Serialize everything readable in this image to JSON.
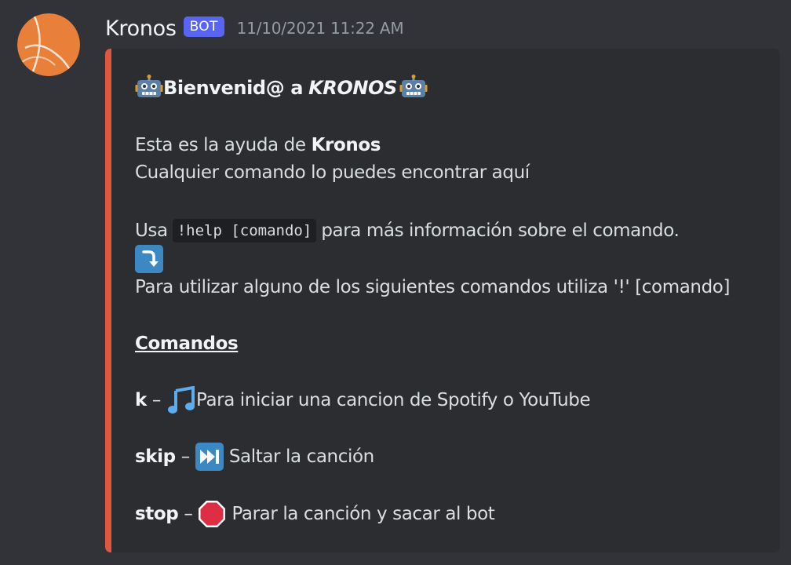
{
  "message": {
    "username": "Kronos",
    "bot_tag": "BOT",
    "timestamp": "11/10/2021 11:22 AM",
    "avatar_icon": "basketball-icon"
  },
  "embed": {
    "accent_color": "#e0573d",
    "title_prefix": "Bienvenid@ a",
    "title_name": "KRONOS",
    "title_emoji": "robot-icon",
    "help_line_prefix": "Esta es la ayuda de",
    "help_line_bold": "Kronos",
    "find_line": "Cualquier comando lo puedes encontrar aquí",
    "usa_prefix": "Usa",
    "usa_code": "!help [comando]",
    "usa_suffix": "para más información sobre el comando.",
    "arrow_emoji": "arrow-down-right-icon",
    "usage_line": "Para utilizar alguno de los siguientes comandos utiliza '!' [comando]",
    "commands_heading": "Comandos",
    "commands": [
      {
        "name": "k",
        "separator": "–",
        "icon": "music-notes-icon",
        "description": "Para iniciar una cancion de Spotify o YouTube"
      },
      {
        "name": "skip",
        "separator": "–",
        "icon": "next-track-icon",
        "description": "Saltar la canción"
      },
      {
        "name": "stop",
        "separator": "–",
        "icon": "stop-sign-icon",
        "description": "Parar la canción y sacar al bot"
      }
    ]
  },
  "colors": {
    "background": "#313338",
    "embed_background": "#2b2d31",
    "bot_tag": "#5865f2",
    "avatar": "#e8803a"
  }
}
